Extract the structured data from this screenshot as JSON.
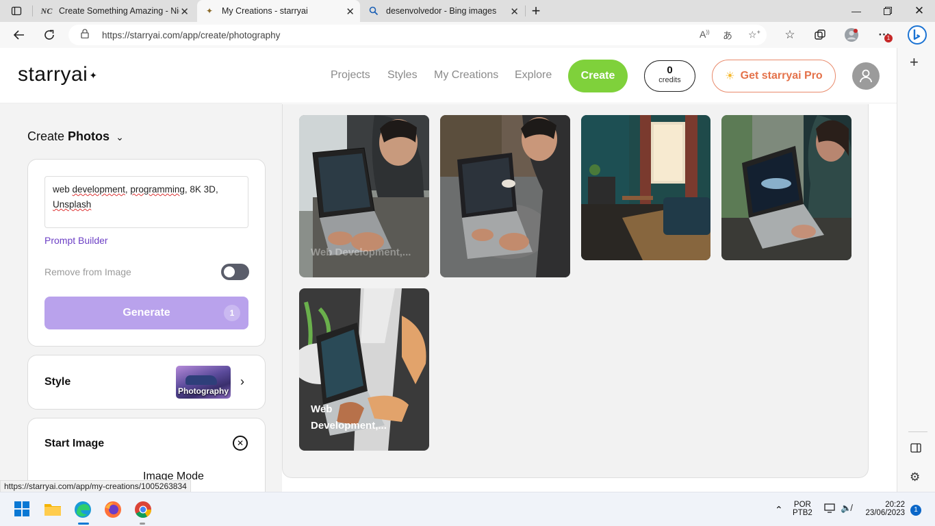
{
  "browser": {
    "tabs": [
      {
        "title": "Create Something Amazing - Nig",
        "icon": "nightcafe-icon"
      },
      {
        "title": "My Creations - starryai",
        "icon": "starryai-icon"
      },
      {
        "title": "desenvolvedor - Bing images",
        "icon": "search-icon"
      }
    ],
    "url": "https://starryai.com/app/create/photography",
    "status_url": "https://starryai.com/app/my-creations/1005263834",
    "extension_badge": "1"
  },
  "header": {
    "logo": "starryai",
    "nav": [
      "Projects",
      "Styles",
      "My Creations",
      "Explore"
    ],
    "create_label": "Create",
    "credits_value": "0",
    "credits_label": "credits",
    "pro_label": "Get starryai Pro"
  },
  "left": {
    "title_prefix": "Create",
    "title_bold": "Photos",
    "prompt_words": [
      "web",
      "development",
      "programming",
      "8K 3D",
      "Unsplash"
    ],
    "prompt_builder": "Prompt Builder",
    "remove_label": "Remove from Image",
    "remove_toggle_on": false,
    "generate_label": "Generate",
    "generate_count": "1",
    "style_label": "Style",
    "style_value": "Photography",
    "start_image_label": "Start Image",
    "image_mode_label": "Image Mode"
  },
  "gallery": {
    "items": [
      {
        "label": "Web Development,..."
      },
      {
        "label": ""
      },
      {
        "label": ""
      },
      {
        "label": ""
      },
      {
        "label_line1": "Web",
        "label_line2": "Development,..."
      }
    ]
  },
  "taskbar": {
    "lang_top": "POR",
    "lang_bottom": "PTB2",
    "time": "20:22",
    "date": "23/06/2023",
    "notifications": "1"
  }
}
